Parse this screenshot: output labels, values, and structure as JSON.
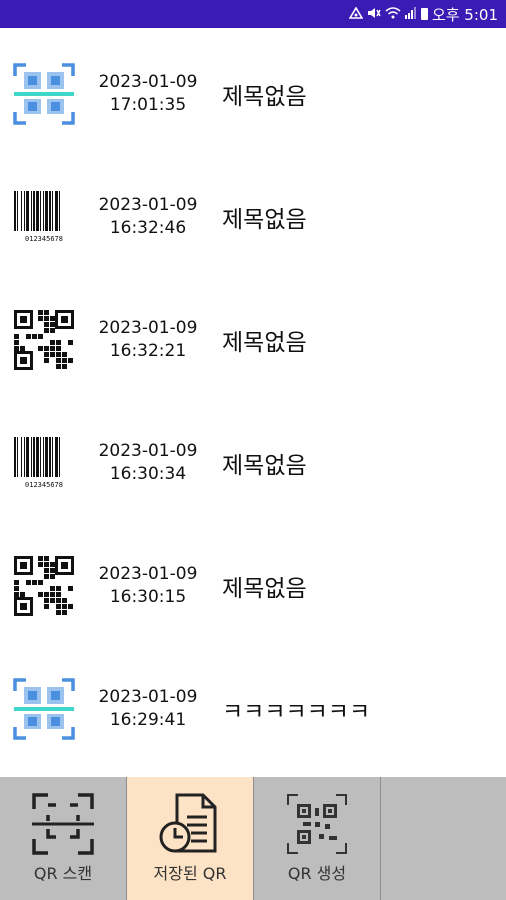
{
  "status_bar": {
    "time": "오후 5:01",
    "icons": [
      "nfc-icon",
      "mute-icon",
      "wifi-icon",
      "signal-icon",
      "battery-icon"
    ]
  },
  "history": [
    {
      "type": "scan-icon",
      "date": "2023-01-09",
      "time": "17:01:35",
      "title": "제목없음"
    },
    {
      "type": "barcode-icon",
      "date": "2023-01-09",
      "time": "16:32:46",
      "title": "제목없음"
    },
    {
      "type": "qr-code-icon",
      "date": "2023-01-09",
      "time": "16:32:21",
      "title": "제목없음"
    },
    {
      "type": "barcode-icon",
      "date": "2023-01-09",
      "time": "16:30:34",
      "title": "제목없음"
    },
    {
      "type": "qr-code-icon",
      "date": "2023-01-09",
      "time": "16:30:15",
      "title": "제목없음"
    },
    {
      "type": "scan-icon",
      "date": "2023-01-09",
      "time": "16:29:41",
      "title": "ㅋㅋㅋㅋㅋㅋㅋ"
    }
  ],
  "barcode_digits": "012345678",
  "nav": {
    "scan_label": "QR 스캔",
    "saved_label": "저장된 QR",
    "create_label": "QR 생성",
    "active": "saved"
  },
  "colors": {
    "status_bar": "#3a1bb3",
    "scan_icon_blue": "#4a8fe0",
    "scan_icon_line": "#3fd8c8",
    "active_tab": "#fde3c6",
    "nav_bg": "#bdbdbd"
  }
}
